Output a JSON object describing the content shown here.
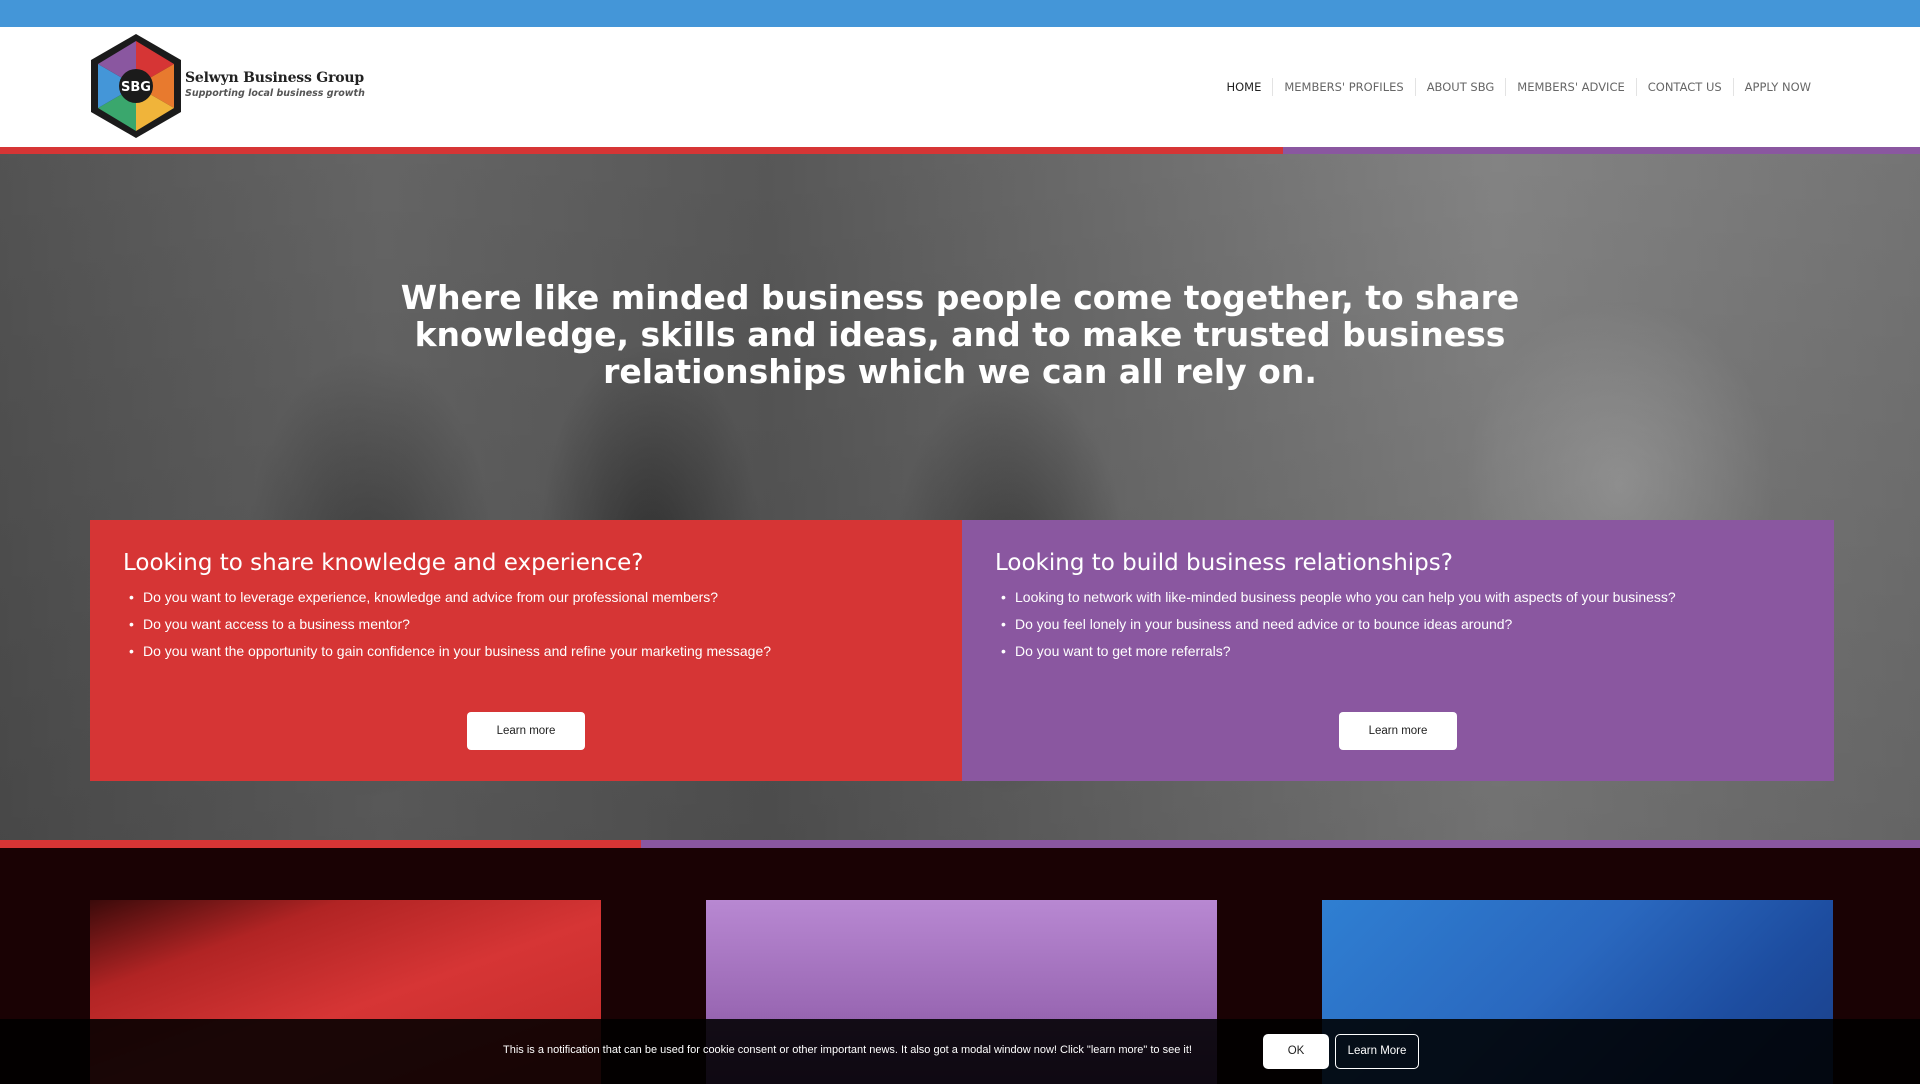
{
  "brand": {
    "name": "Selwyn Business Group",
    "tagline": "Supporting local business growth",
    "logo_text": "SBG",
    "colors": {
      "blue": "#4496d8",
      "red": "#d63535",
      "purple": "#8a57a0"
    }
  },
  "nav": {
    "items": [
      {
        "label": "HOME",
        "active": true
      },
      {
        "label": "MEMBERS' PROFILES"
      },
      {
        "label": "ABOUT SBG"
      },
      {
        "label": "MEMBERS' ADVICE"
      },
      {
        "label": "CONTACT US"
      },
      {
        "label": "APPLY NOW"
      }
    ]
  },
  "hero": {
    "headline": "Where like minded business people come together, to share knowledge, skills and ideas, and to make trusted business relationships which we can all rely on."
  },
  "cards": [
    {
      "title": "Looking to share knowledge and experience?",
      "bullets": [
        "Do you want to leverage experience, knowledge and advice from our professional members?",
        "Do you want access to a business mentor?",
        "Do you want the opportunity to gain confidence in your business and refine your marketing message?"
      ],
      "button": "Learn more"
    },
    {
      "title": "Looking to build business relationships?",
      "bullets": [
        "Looking to network with like-minded business people who you can help you with aspects of your business?",
        "Do you feel lonely in your business and need advice or to bounce ideas around?",
        "Do you want to get more referrals?"
      ],
      "button": "Learn more"
    }
  ],
  "cookie_bar": {
    "message": "This is a notification that can be used for cookie consent or other important news. It also got a modal window now! Click \"learn more\" to see it!",
    "ok_label": "OK",
    "learn_more_label": "Learn More"
  }
}
